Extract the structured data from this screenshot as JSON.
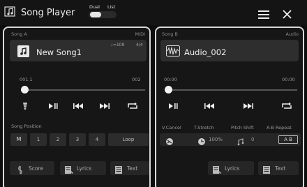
{
  "header": {
    "title": "Song Player",
    "mode_dual": "Dual",
    "mode_list": "List"
  },
  "song_a": {
    "label": "Song A",
    "type": "MIDI",
    "name": "New Song1",
    "tempo": "♩=109",
    "time_sig": "4/4",
    "position": "001.1",
    "length": "002",
    "progress": 0,
    "position_label": "Song Position",
    "position_buttons": [
      "M",
      "1",
      "2",
      "3",
      "4",
      "Loop"
    ],
    "score_label": "Score",
    "lyrics_label": "Lyrics",
    "text_label": "Text"
  },
  "song_b": {
    "label": "Song B",
    "type": "Audio",
    "name": "Audio_002",
    "position": "00:00",
    "length": "00:00",
    "progress": 0,
    "tools": {
      "vcancel_label": "V.Cancel",
      "tstretch_label": "T.Stretch",
      "pitchshift_label": "Pitch Shift",
      "abrepeat_label": "A-B Repeat",
      "tstretch_value": "100%",
      "pitch_value": "0",
      "ab_value": "A B"
    },
    "lyrics_label": "Lyrics",
    "text_label": "Text"
  }
}
